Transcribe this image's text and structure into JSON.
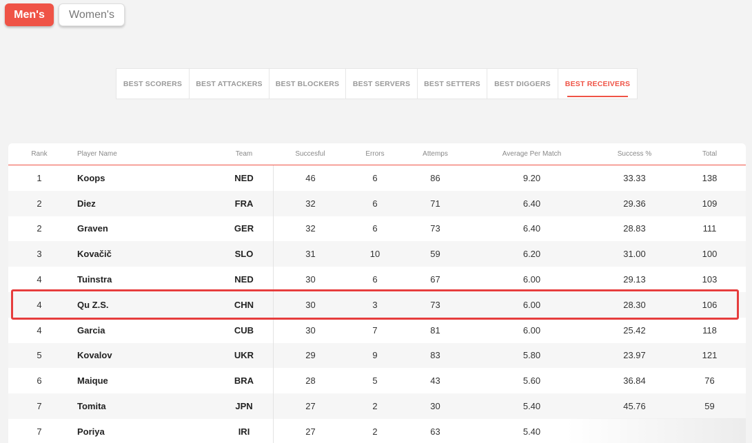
{
  "gender_tabs": {
    "men": "Men's",
    "women": "Women's"
  },
  "category_tabs": [
    "BEST SCORERS",
    "BEST ATTACKERS",
    "BEST BLOCKERS",
    "BEST SERVERS",
    "BEST SETTERS",
    "BEST DIGGERS",
    "BEST RECEIVERS"
  ],
  "active_category": "BEST RECEIVERS",
  "accent_color": "#ef5346",
  "table": {
    "headers": {
      "rank": "Rank",
      "player": "Player Name",
      "team": "Team",
      "successful": "Succesful",
      "errors": "Errors",
      "attempts": "Attemps",
      "avg": "Average Per Match",
      "pct": "Success %",
      "total": "Total"
    },
    "rows": [
      {
        "rank": "1",
        "player": "Koops",
        "team": "NED",
        "successful": "46",
        "errors": "6",
        "attempts": "86",
        "avg": "9.20",
        "pct": "33.33",
        "total": "138"
      },
      {
        "rank": "2",
        "player": "Diez",
        "team": "FRA",
        "successful": "32",
        "errors": "6",
        "attempts": "71",
        "avg": "6.40",
        "pct": "29.36",
        "total": "109"
      },
      {
        "rank": "2",
        "player": "Graven",
        "team": "GER",
        "successful": "32",
        "errors": "6",
        "attempts": "73",
        "avg": "6.40",
        "pct": "28.83",
        "total": "111"
      },
      {
        "rank": "3",
        "player": "Kovačič",
        "team": "SLO",
        "successful": "31",
        "errors": "10",
        "attempts": "59",
        "avg": "6.20",
        "pct": "31.00",
        "total": "100"
      },
      {
        "rank": "4",
        "player": "Tuinstra",
        "team": "NED",
        "successful": "30",
        "errors": "6",
        "attempts": "67",
        "avg": "6.00",
        "pct": "29.13",
        "total": "103"
      },
      {
        "rank": "4",
        "player": "Qu Z.S.",
        "team": "CHN",
        "successful": "30",
        "errors": "3",
        "attempts": "73",
        "avg": "6.00",
        "pct": "28.30",
        "total": "106"
      },
      {
        "rank": "4",
        "player": "Garcia",
        "team": "CUB",
        "successful": "30",
        "errors": "7",
        "attempts": "81",
        "avg": "6.00",
        "pct": "25.42",
        "total": "118"
      },
      {
        "rank": "5",
        "player": "Kovalov",
        "team": "UKR",
        "successful": "29",
        "errors": "9",
        "attempts": "83",
        "avg": "5.80",
        "pct": "23.97",
        "total": "121"
      },
      {
        "rank": "6",
        "player": "Maique",
        "team": "BRA",
        "successful": "28",
        "errors": "5",
        "attempts": "43",
        "avg": "5.60",
        "pct": "36.84",
        "total": "76"
      },
      {
        "rank": "7",
        "player": "Tomita",
        "team": "JPN",
        "successful": "27",
        "errors": "2",
        "attempts": "30",
        "avg": "5.40",
        "pct": "45.76",
        "total": "59"
      },
      {
        "rank": "7",
        "player": "Poriya",
        "team": "IRI",
        "successful": "27",
        "errors": "2",
        "attempts": "63",
        "avg": "5.40",
        "pct": "",
        "total": ""
      }
    ]
  },
  "highlight_color": "#e63d3d"
}
